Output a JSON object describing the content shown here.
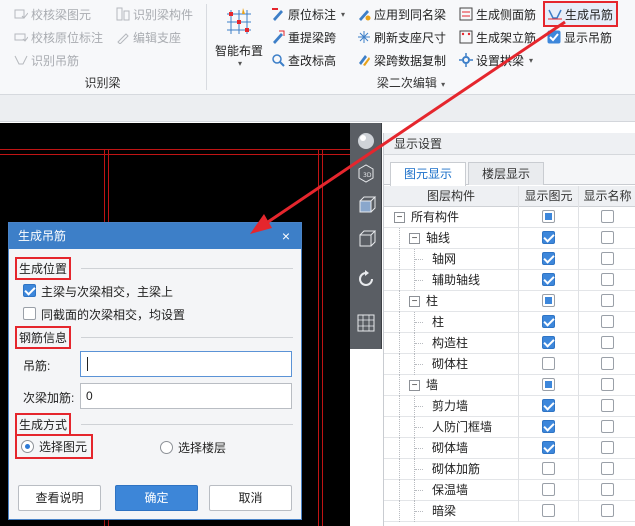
{
  "ribbon": {
    "group1": {
      "title": "识别梁",
      "items": [
        {
          "label": "校核梁图元",
          "icon": "check-beam-icon"
        },
        {
          "label": "识别梁构件",
          "icon": "recognize-beam-component-icon"
        },
        {
          "label": "校核原位标注",
          "icon": "check-annotation-icon"
        },
        {
          "label": "编辑支座",
          "icon": "edit-support-icon"
        },
        {
          "label": "识别吊筋",
          "icon": "recognize-hanger-icon"
        }
      ]
    },
    "group2": {
      "title": "梁二次编辑",
      "big_button": {
        "label": "智能布置",
        "icon": "smart-layout-icon"
      },
      "items": [
        {
          "label": "原位标注",
          "icon": "annotation-icon"
        },
        {
          "label": "应用到同名梁",
          "icon": "apply-same-name-icon"
        },
        {
          "label": "生成侧面筋",
          "icon": "side-rebar-icon"
        },
        {
          "label": "生成吊筋",
          "icon": "hanger-rebar-icon"
        },
        {
          "label": "重提梁跨",
          "icon": "reextract-span-icon"
        },
        {
          "label": "刷新支座尺寸",
          "icon": "refresh-support-icon"
        },
        {
          "label": "生成架立筋",
          "icon": "erection-rebar-icon"
        },
        {
          "label": "显示吊筋",
          "icon": "show-hanger-icon"
        },
        {
          "label": "查改标高",
          "icon": "edit-elevation-icon"
        },
        {
          "label": "梁跨数据复制",
          "icon": "copy-span-data-icon"
        },
        {
          "label": "设置拱梁",
          "icon": "arch-beam-icon"
        }
      ]
    }
  },
  "panel": {
    "title": "显示设置",
    "tabs": [
      {
        "label": "图元显示"
      },
      {
        "label": "楼层显示"
      }
    ],
    "columns": [
      "图层构件",
      "显示图元",
      "显示名称"
    ],
    "rows": [
      {
        "label": "所有构件",
        "level": 0,
        "toggle": "−",
        "show": "partial",
        "name": "off"
      },
      {
        "label": "轴线",
        "level": 1,
        "toggle": "−",
        "show": "on",
        "name": "off"
      },
      {
        "label": "轴网",
        "level": 2,
        "toggle": "",
        "show": "on",
        "name": "off"
      },
      {
        "label": "辅助轴线",
        "level": 2,
        "toggle": "",
        "show": "on",
        "name": "off"
      },
      {
        "label": "柱",
        "level": 1,
        "toggle": "−",
        "show": "partial",
        "name": "off"
      },
      {
        "label": "柱",
        "level": 2,
        "toggle": "",
        "show": "on",
        "name": "off"
      },
      {
        "label": "构造柱",
        "level": 2,
        "toggle": "",
        "show": "on",
        "name": "off"
      },
      {
        "label": "砌体柱",
        "level": 2,
        "toggle": "",
        "show": "off",
        "name": "off"
      },
      {
        "label": "墙",
        "level": 1,
        "toggle": "−",
        "show": "partial",
        "name": "off"
      },
      {
        "label": "剪力墙",
        "level": 2,
        "toggle": "",
        "show": "on",
        "name": "off"
      },
      {
        "label": "人防门框墙",
        "level": 2,
        "toggle": "",
        "show": "on",
        "name": "off"
      },
      {
        "label": "砌体墙",
        "level": 2,
        "toggle": "",
        "show": "on",
        "name": "off"
      },
      {
        "label": "砌体加筋",
        "level": 2,
        "toggle": "",
        "show": "off",
        "name": "off"
      },
      {
        "label": "保温墙",
        "level": 2,
        "toggle": "",
        "show": "off",
        "name": "off"
      },
      {
        "label": "暗梁",
        "level": 2,
        "toggle": "",
        "show": "off",
        "name": "off"
      }
    ]
  },
  "dialog": {
    "title": "生成吊筋",
    "close": "×",
    "section1": "生成位置",
    "opt1": "主梁与次梁相交，主梁上",
    "opt2": "同截面的次梁相交，均设置",
    "section2": "钢筋信息",
    "field1_label": "吊筋:",
    "field1_value": "",
    "field2_label": "次梁加筋:",
    "field2_value": "0",
    "section3": "生成方式",
    "radio1": "选择图元",
    "radio2": "选择楼层",
    "btn_help": "查看说明",
    "btn_ok": "确定",
    "btn_cancel": "取消"
  },
  "colors": {
    "accent": "#3d7fc8",
    "highlight": "#e5262d",
    "canvas": "#000000",
    "grid_line": "#c01414"
  }
}
